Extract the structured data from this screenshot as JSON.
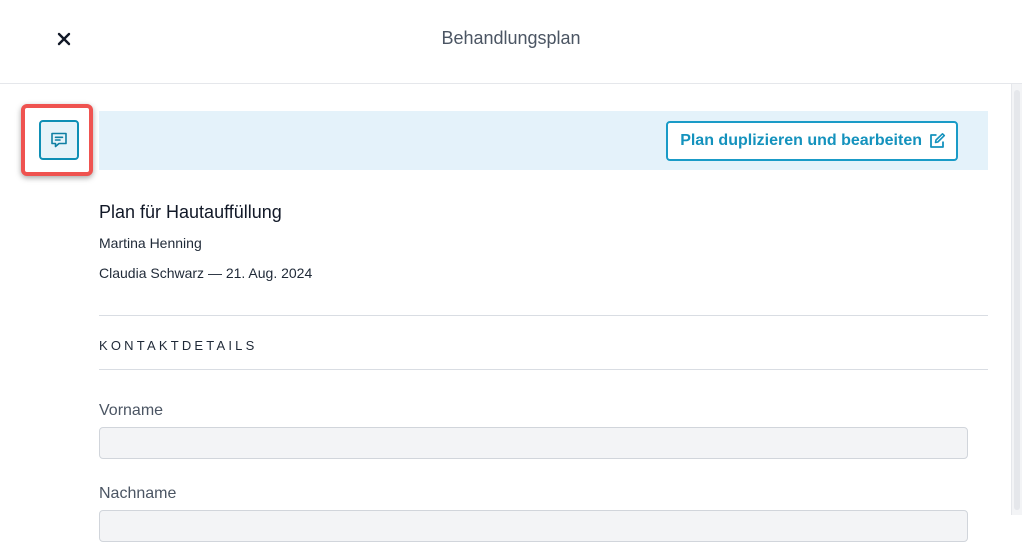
{
  "header": {
    "title": "Behandlungsplan",
    "close_icon": "close-icon"
  },
  "toolbar": {
    "comment_icon": "comment-icon",
    "duplicate_label": "Plan duplizieren und bearbeiten",
    "duplicate_icon": "edit-icon"
  },
  "plan": {
    "title": "Plan für Hautauffüllung",
    "patient": "Martina Henning",
    "author_line": "Claudia Schwarz — 21. Aug. 2024"
  },
  "contact": {
    "heading": "KONTAKTDETAILS",
    "fields": [
      {
        "label": "Vorname",
        "value": ""
      },
      {
        "label": "Nachname",
        "value": ""
      }
    ]
  },
  "colors": {
    "accent": "#1a9bc7",
    "banner": "#e4f2fa",
    "highlight": "#ef5350"
  }
}
